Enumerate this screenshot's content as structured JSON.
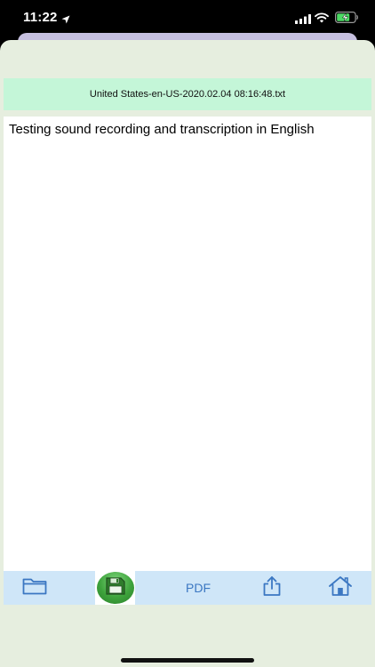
{
  "status_bar": {
    "time": "11:22",
    "icons": [
      "location-arrow-icon",
      "cellular-signal-icon",
      "wifi-icon",
      "battery-charging-icon"
    ]
  },
  "file": {
    "name": "United States-en-US-2020.02.04 08:16:48.txt"
  },
  "document": {
    "text": "Testing sound recording and transcription in English"
  },
  "toolbar": {
    "open_icon": "folder-icon",
    "save_icon": "floppy-disk-icon",
    "pdf_label": "PDF",
    "share_icon": "share-icon",
    "home_icon": "home-icon"
  },
  "colors": {
    "header_bg": "#c4f6d8",
    "sheet_bg": "#e6eedf",
    "toolbar_bg": "#cfe6f8",
    "accent_blue": "#3b77c2",
    "save_green": "#3ea33c"
  }
}
